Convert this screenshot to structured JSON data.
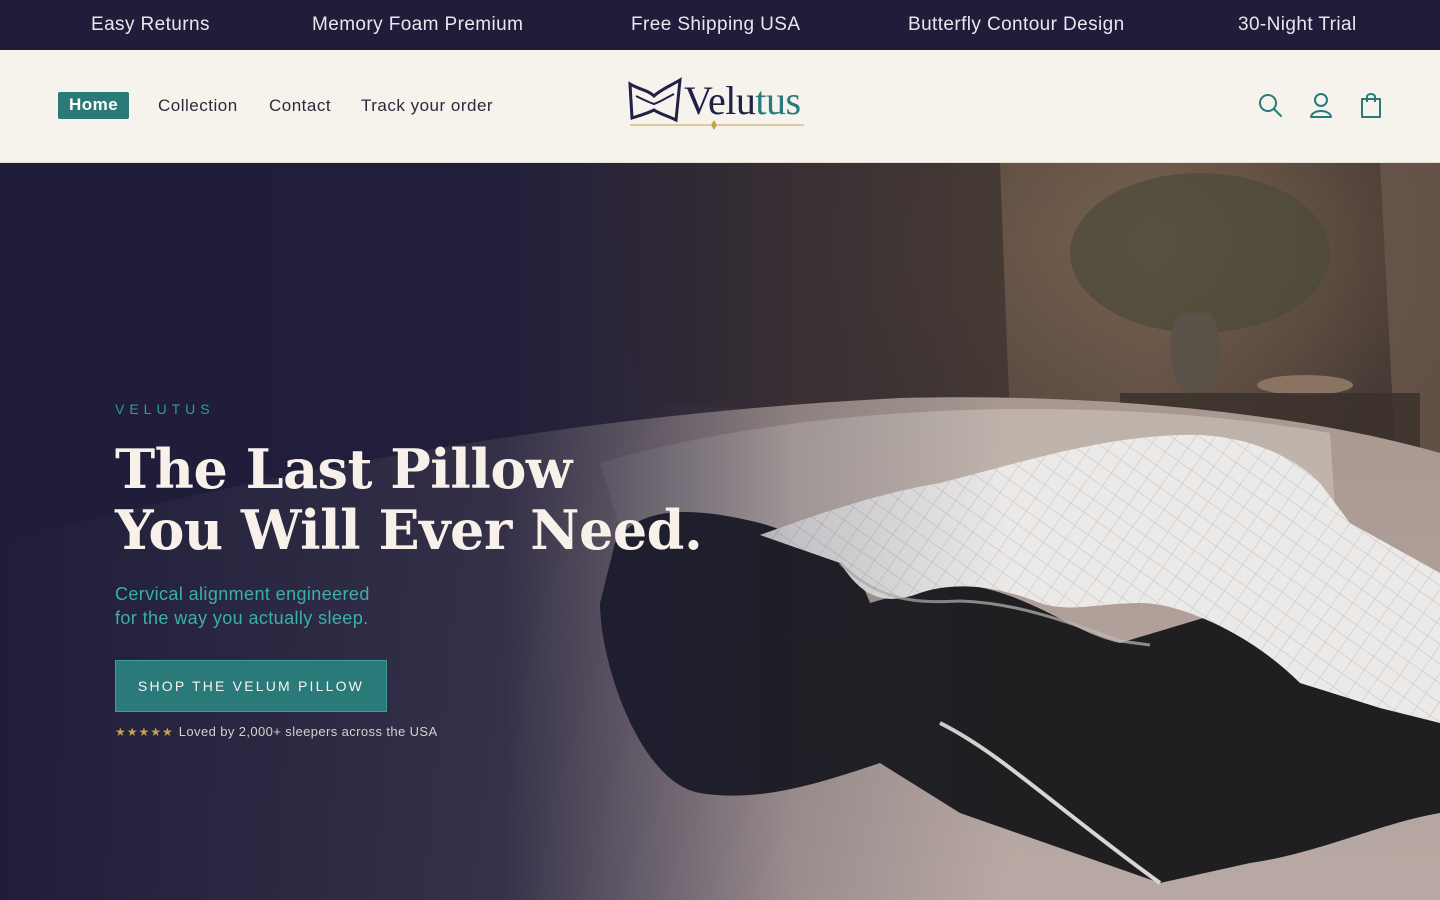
{
  "colors": {
    "brand_navy": "#1f1d3a",
    "brand_teal": "#2a7a7a",
    "cream": "#f6f2ec",
    "accent_teal_text": "#3ab0aa",
    "gold": "#c9a04a"
  },
  "announcement": {
    "items": [
      "Easy Returns",
      "Memory Foam Premium",
      "Free Shipping USA",
      "Butterfly Contour Design",
      "30-Night Trial"
    ]
  },
  "header": {
    "nav": [
      {
        "label": "Home",
        "active": true
      },
      {
        "label": "Collection",
        "active": false
      },
      {
        "label": "Contact",
        "active": false
      },
      {
        "label": "Track your order",
        "active": false
      }
    ],
    "logo": {
      "text": "Velutus"
    },
    "icons": [
      "search-icon",
      "account-icon",
      "cart-icon"
    ]
  },
  "hero": {
    "eyebrow": "VELUTUS",
    "headline": [
      "The Last Pillow",
      "You Will Ever Need."
    ],
    "subheadline": [
      "Cervical alignment engineered",
      "for the way you actually sleep."
    ],
    "cta_label": "SHOP THE VELUM PILLOW",
    "rating_stars": 5,
    "stars": "★★★★★",
    "social_proof": "Loved by 2,000+ sleepers across the USA"
  }
}
